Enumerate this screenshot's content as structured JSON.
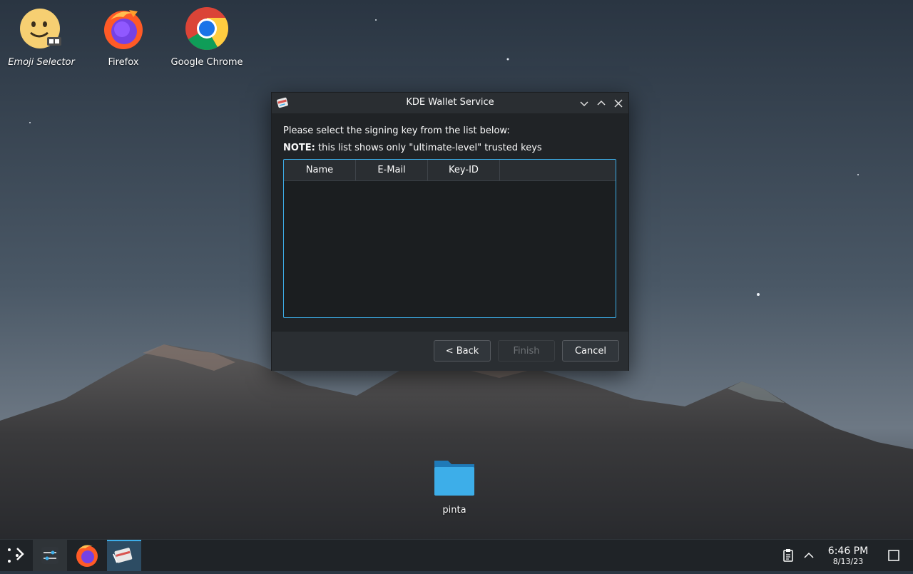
{
  "desktop": {
    "icons": [
      {
        "label": "Emoji Selector",
        "icon": "emoji-selector-icon"
      },
      {
        "label": "Firefox",
        "icon": "firefox-icon"
      },
      {
        "label": "Google Chrome",
        "icon": "chrome-icon"
      }
    ],
    "folder": {
      "label": "pinta",
      "icon": "folder-icon"
    }
  },
  "dialog": {
    "title": "KDE Wallet Service",
    "instruction": "Please select the signing key from the list below:",
    "note_prefix": "NOTE:",
    "note_text": " this list shows only \"ultimate-level\" trusted keys",
    "columns": [
      "Name",
      "E-Mail",
      "Key-ID"
    ],
    "rows": [],
    "buttons": {
      "back": "< Back",
      "finish": "Finish",
      "cancel": "Cancel"
    },
    "titlebar_controls": [
      "minimize",
      "maximize",
      "close"
    ]
  },
  "taskbar": {
    "items": [
      "app-launcher-icon",
      "system-settings-icon",
      "firefox-icon",
      "kwallet-icon"
    ],
    "tray": [
      "clipboard-icon",
      "chevron-up-icon"
    ],
    "time": "6:46 PM",
    "date": "8/13/23"
  },
  "colors": {
    "accent": "#3daee9",
    "dialog_bg": "#2a2e32",
    "list_bg": "#1b1e20"
  }
}
